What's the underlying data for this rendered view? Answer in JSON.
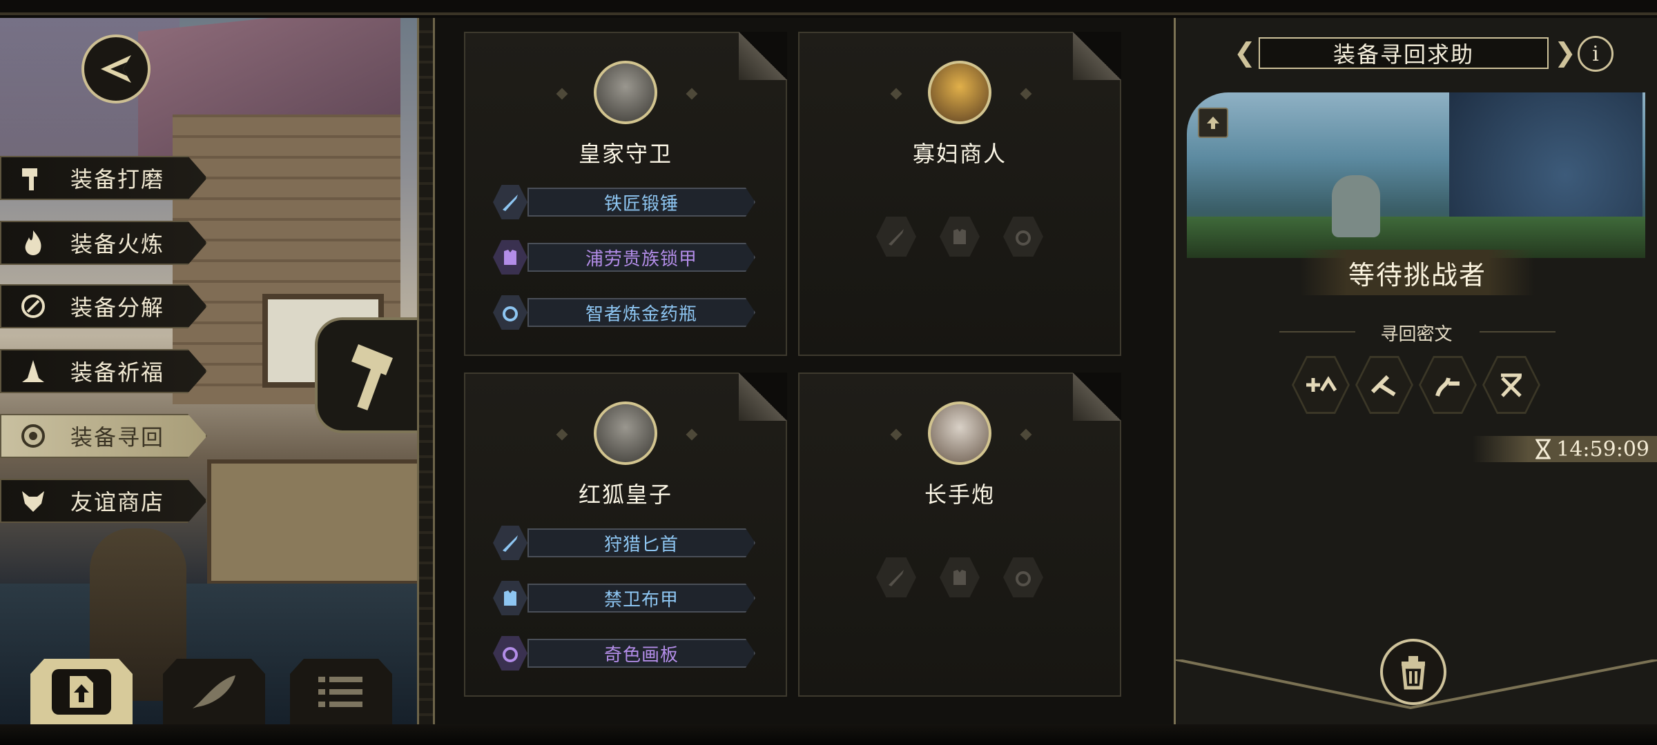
{
  "menu": {
    "items": [
      {
        "label": "装备打磨",
        "icon": "hammer-icon",
        "active": false
      },
      {
        "label": "装备火炼",
        "icon": "flame-icon",
        "active": false
      },
      {
        "label": "装备分解",
        "icon": "disassemble-icon",
        "active": false
      },
      {
        "label": "装备祈福",
        "icon": "pray-hands-icon",
        "active": false
      },
      {
        "label": "装备寻回",
        "icon": "target-icon",
        "active": true
      },
      {
        "label": "友谊商店",
        "icon": "fox-icon",
        "active": false
      }
    ]
  },
  "bottom_bar": {
    "buttons": [
      {
        "icon": "upload-icon",
        "active": true
      },
      {
        "icon": "feather-icon",
        "active": false
      },
      {
        "icon": "list-icon",
        "active": false
      }
    ]
  },
  "cards": [
    {
      "name": "皇家守卫",
      "items": [
        {
          "label": "铁匠锻锤",
          "slot": "weapon",
          "color": "#8ec6f2"
        },
        {
          "label": "浦劳贵族锁甲",
          "slot": "armor",
          "color": "#b38de8"
        },
        {
          "label": "智者炼金药瓶",
          "slot": "ring",
          "color": "#8ec6f2"
        }
      ]
    },
    {
      "name": "寡妇商人",
      "items": []
    },
    {
      "name": "红狐皇子",
      "items": [
        {
          "label": "狩猎匕首",
          "slot": "weapon",
          "color": "#8ec6f2"
        },
        {
          "label": "禁卫布甲",
          "slot": "armor",
          "color": "#8ec6f2"
        },
        {
          "label": "奇色画板",
          "slot": "ring",
          "color": "#b38de8"
        }
      ]
    },
    {
      "name": "长手炮",
      "items": []
    }
  ],
  "right_panel": {
    "title": "装备寻回求助",
    "status_banner": "等待挑战者",
    "runes_heading": "寻回密文",
    "timer": "14:59:09"
  },
  "colors": {
    "accent_gold": "#cfc39b",
    "blue_rarity": "#8ec6f2",
    "purple_rarity": "#b38de8"
  }
}
